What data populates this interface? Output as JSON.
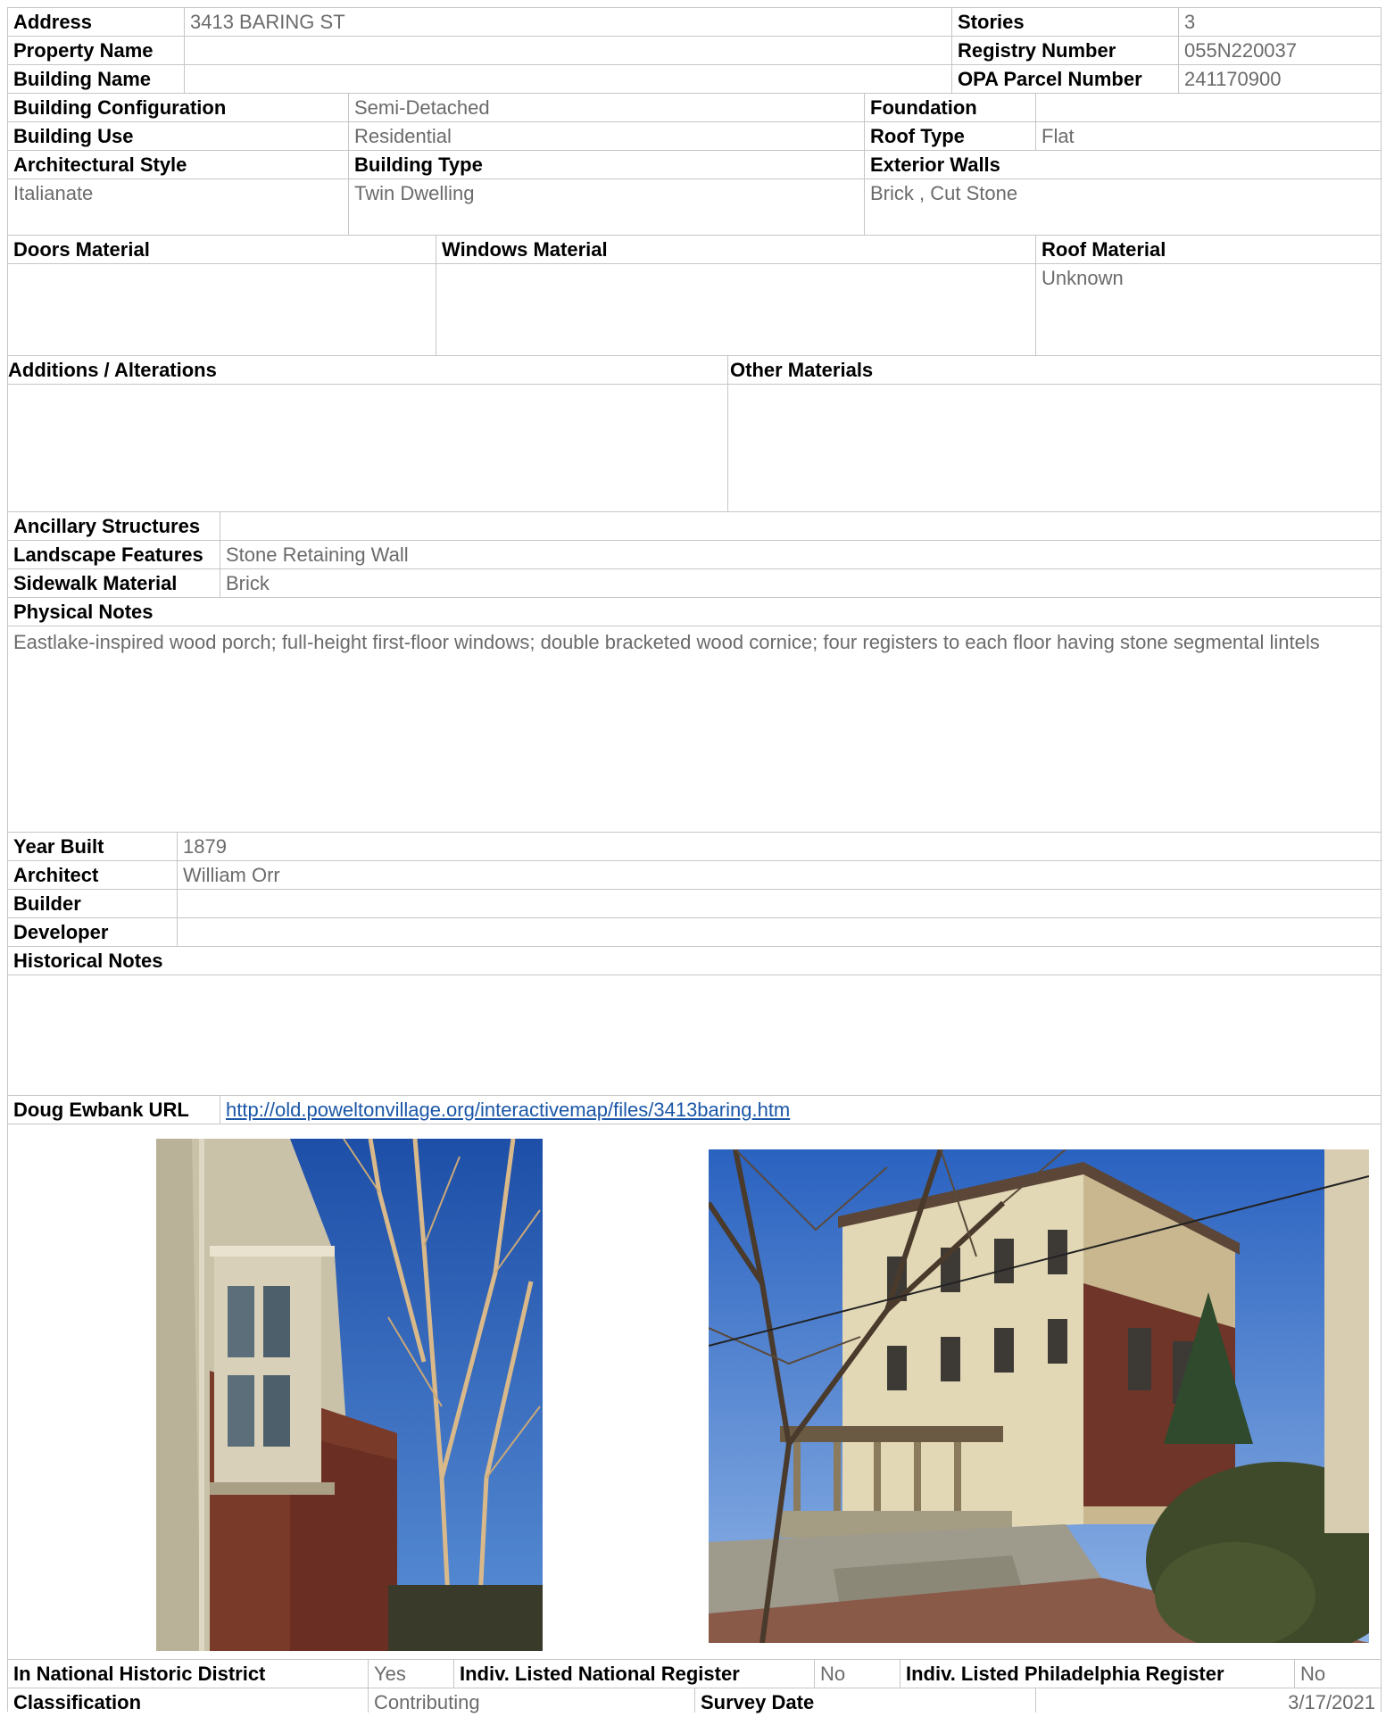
{
  "identity": {
    "address_label": "Address",
    "address_value": "3413 BARING ST",
    "property_name_label": "Property Name",
    "property_name_value": "",
    "building_name_label": "Building Name",
    "building_name_value": "",
    "stories_label": "Stories",
    "stories_value": "3",
    "registry_number_label": "Registry Number",
    "registry_number_value": "055N220037",
    "opa_parcel_label": "OPA Parcel Number",
    "opa_parcel_value": "241170900"
  },
  "configuration": {
    "building_configuration_label": "Building Configuration",
    "building_configuration_value": "Semi-Detached",
    "foundation_label": "Foundation",
    "foundation_value": "",
    "building_use_label": "Building Use",
    "building_use_value": "Residential",
    "roof_type_label": "Roof Type",
    "roof_type_value": "Flat",
    "architectural_style_label": "Architectural Style",
    "architectural_style_value": "Italianate",
    "building_type_label": "Building Type",
    "building_type_value": "Twin Dwelling",
    "exterior_walls_label": "Exterior Walls",
    "exterior_walls_value": "Brick , Cut Stone"
  },
  "materials": {
    "doors_label": "Doors Material",
    "doors_value": "",
    "windows_label": "Windows Material",
    "windows_value": "",
    "roof_material_label": "Roof Material",
    "roof_material_value": "Unknown",
    "additions_label": "Additions / Alterations",
    "additions_value": "",
    "other_materials_label": "Other Materials",
    "other_materials_value": ""
  },
  "site": {
    "ancillary_label": "Ancillary Structures",
    "ancillary_value": "",
    "landscape_label": "Landscape Features",
    "landscape_value": "Stone Retaining Wall",
    "sidewalk_label": "Sidewalk Material",
    "sidewalk_value": "Brick"
  },
  "physical_notes": {
    "label": "Physical Notes",
    "text": "Eastlake-inspired wood porch; full-height first-floor windows; double bracketed wood cornice; four registers to each floor having stone segmental lintels"
  },
  "history": {
    "year_built_label": "Year Built",
    "year_built_value": "1879",
    "architect_label": "Architect",
    "architect_value": "William Orr",
    "builder_label": "Builder",
    "builder_value": "",
    "developer_label": "Developer",
    "developer_value": "",
    "historical_notes_label": "Historical Notes",
    "historical_notes_value": ""
  },
  "links": {
    "doug_ewbank_label": "Doug Ewbank URL",
    "doug_ewbank_url": "http://old.poweltonvillage.org/interactivemap/files/3413baring.htm"
  },
  "status": {
    "national_district_label": "In National Historic District",
    "national_district_value": "Yes",
    "national_register_label": "Indiv. Listed National Register",
    "national_register_value": "No",
    "philadelphia_register_label": "Indiv. Listed Philadelphia Register",
    "philadelphia_register_value": "No",
    "classification_label": "Classification",
    "classification_value": "Contributing",
    "survey_date_label": "Survey Date",
    "survey_date_value": "3/17/2021"
  },
  "colors": {
    "label_text": "#000000",
    "value_text": "#6b6b6b",
    "link": "#1a56a6",
    "grid": "#c6c6c6"
  }
}
